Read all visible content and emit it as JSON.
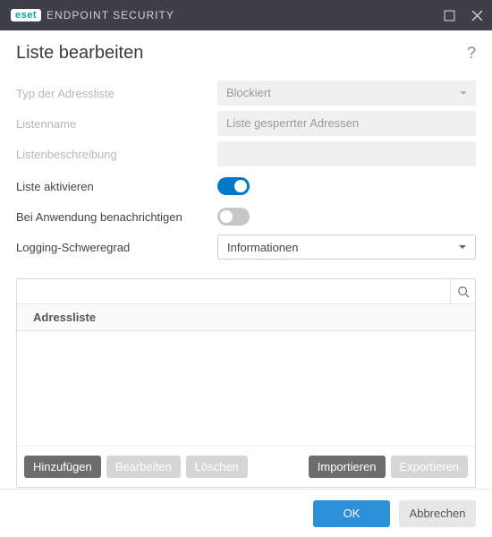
{
  "app": {
    "brand": "eset",
    "product": "ENDPOINT SECURITY"
  },
  "page": {
    "title": "Liste bearbeiten"
  },
  "form": {
    "addr_type_label": "Typ der Adressliste",
    "addr_type_value": "Blockiert",
    "list_name_label": "Listenname",
    "list_name_value": "Liste gesperrter Adressen",
    "list_desc_label": "Listenbeschreibung",
    "list_desc_value": "",
    "enable_label": "Liste aktivieren",
    "notify_label": "Bei Anwendung benachrichtigen",
    "log_label": "Logging-Schweregrad",
    "log_value": "Informationen"
  },
  "list": {
    "header": "Adressliste",
    "search_placeholder": ""
  },
  "buttons": {
    "add": "Hinzufügen",
    "edit": "Bearbeiten",
    "delete": "Löschen",
    "import": "Importieren",
    "export": "Exportieren",
    "ok": "OK",
    "cancel": "Abbrechen"
  }
}
